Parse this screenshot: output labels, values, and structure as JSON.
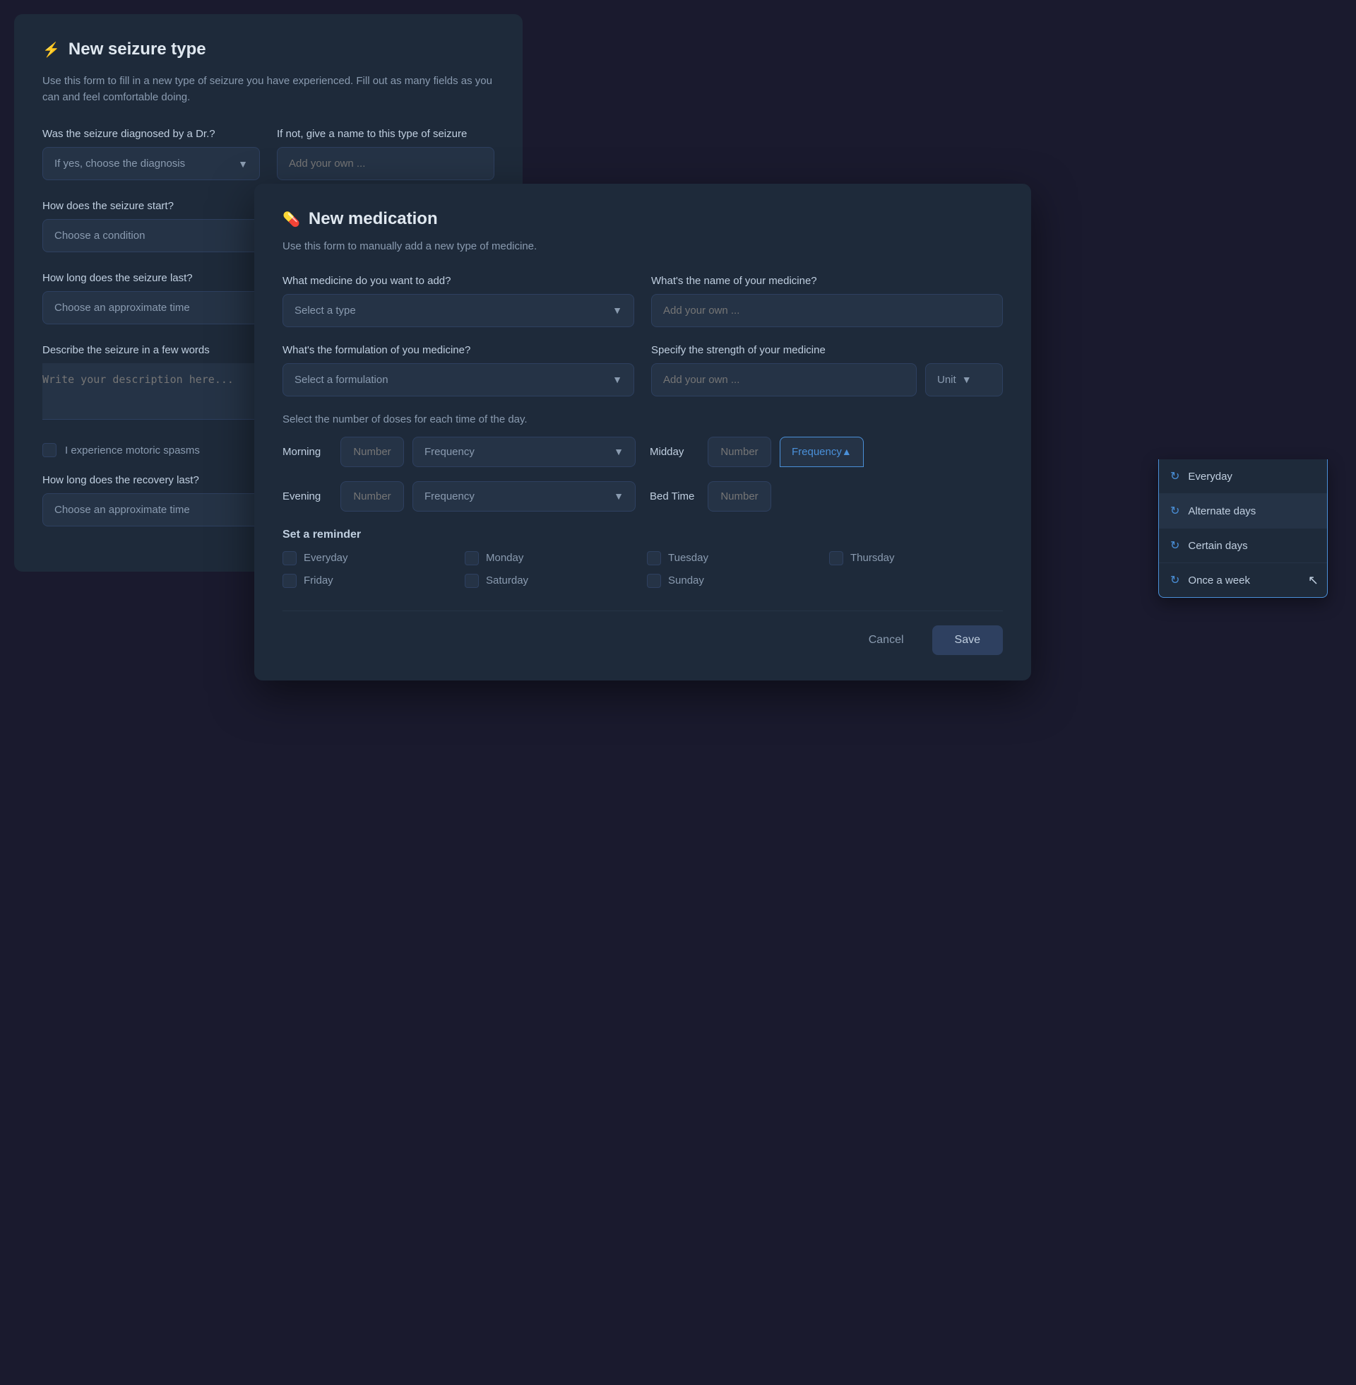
{
  "seizure_modal": {
    "title": "New seizure type",
    "subtitle": "Use this form to fill in a new type of seizure you have experienced. Fill out as many fields as you can and feel comfortable doing.",
    "diagnosis_label": "Was the seizure diagnosed by a Dr.?",
    "diagnosis_placeholder": "If yes, choose the diagnosis",
    "name_label": "If not, give a name to this type of seizure",
    "name_placeholder": "Add your own ...",
    "start_label": "How does the seizure start?",
    "start_placeholder": "Choose a condition",
    "duration_label": "How long does the seizure last?",
    "duration_placeholder": "Choose an approximate time",
    "describe_label": "Describe the seizure in a few words",
    "describe_placeholder": "Write your description here...",
    "spasms_label": "I experience motoric spasms",
    "recovery_label": "How long does the recovery last?",
    "recovery_placeholder": "Choose an approximate time"
  },
  "medication_modal": {
    "title": "New medication",
    "subtitle": "Use this form to manually add a new type of medicine.",
    "what_medicine_label": "What medicine do you want  to add?",
    "what_medicine_placeholder": "Select a type",
    "medicine_name_label": "What's the name of your medicine?",
    "medicine_name_placeholder": "Add your own ...",
    "formulation_label": "What's the formulation of you medicine?",
    "formulation_placeholder": "Select a formulation",
    "strength_label": "Specify the strength of your medicine",
    "strength_placeholder": "Add your own ...",
    "unit_label": "Unit",
    "doses_section_label": "Select the number of doses for each time of the day.",
    "morning_label": "Morning",
    "number_placeholder": "Number",
    "frequency_placeholder": "Frequency",
    "midday_label": "Midday",
    "evening_label": "Evening",
    "bedtime_label": "Bed Time",
    "reminder_label": "Set a reminder",
    "days": [
      "Everyday",
      "Monday",
      "Tuesday",
      "Thursday",
      "Friday",
      "Saturday",
      "Sunday"
    ],
    "frequency_active": "Frequency",
    "cancel_label": "Cancel",
    "save_label": "Save",
    "dropdown": {
      "options": [
        {
          "label": "Everyday",
          "icon": "↻"
        },
        {
          "label": "Alternate days",
          "icon": "↻"
        },
        {
          "label": "Certain days",
          "icon": "↻"
        },
        {
          "label": "Once a week",
          "icon": "↻"
        }
      ]
    }
  },
  "colors": {
    "bg_dark": "#1a1a2e",
    "bg_modal": "#1e2a3a",
    "bg_input": "#253346",
    "border": "#2e4060",
    "border_active": "#4a90d9",
    "text_primary": "#e0e8f0",
    "text_secondary": "#c0cfe0",
    "text_muted": "#8a9bb0",
    "accent": "#4a90d9"
  }
}
